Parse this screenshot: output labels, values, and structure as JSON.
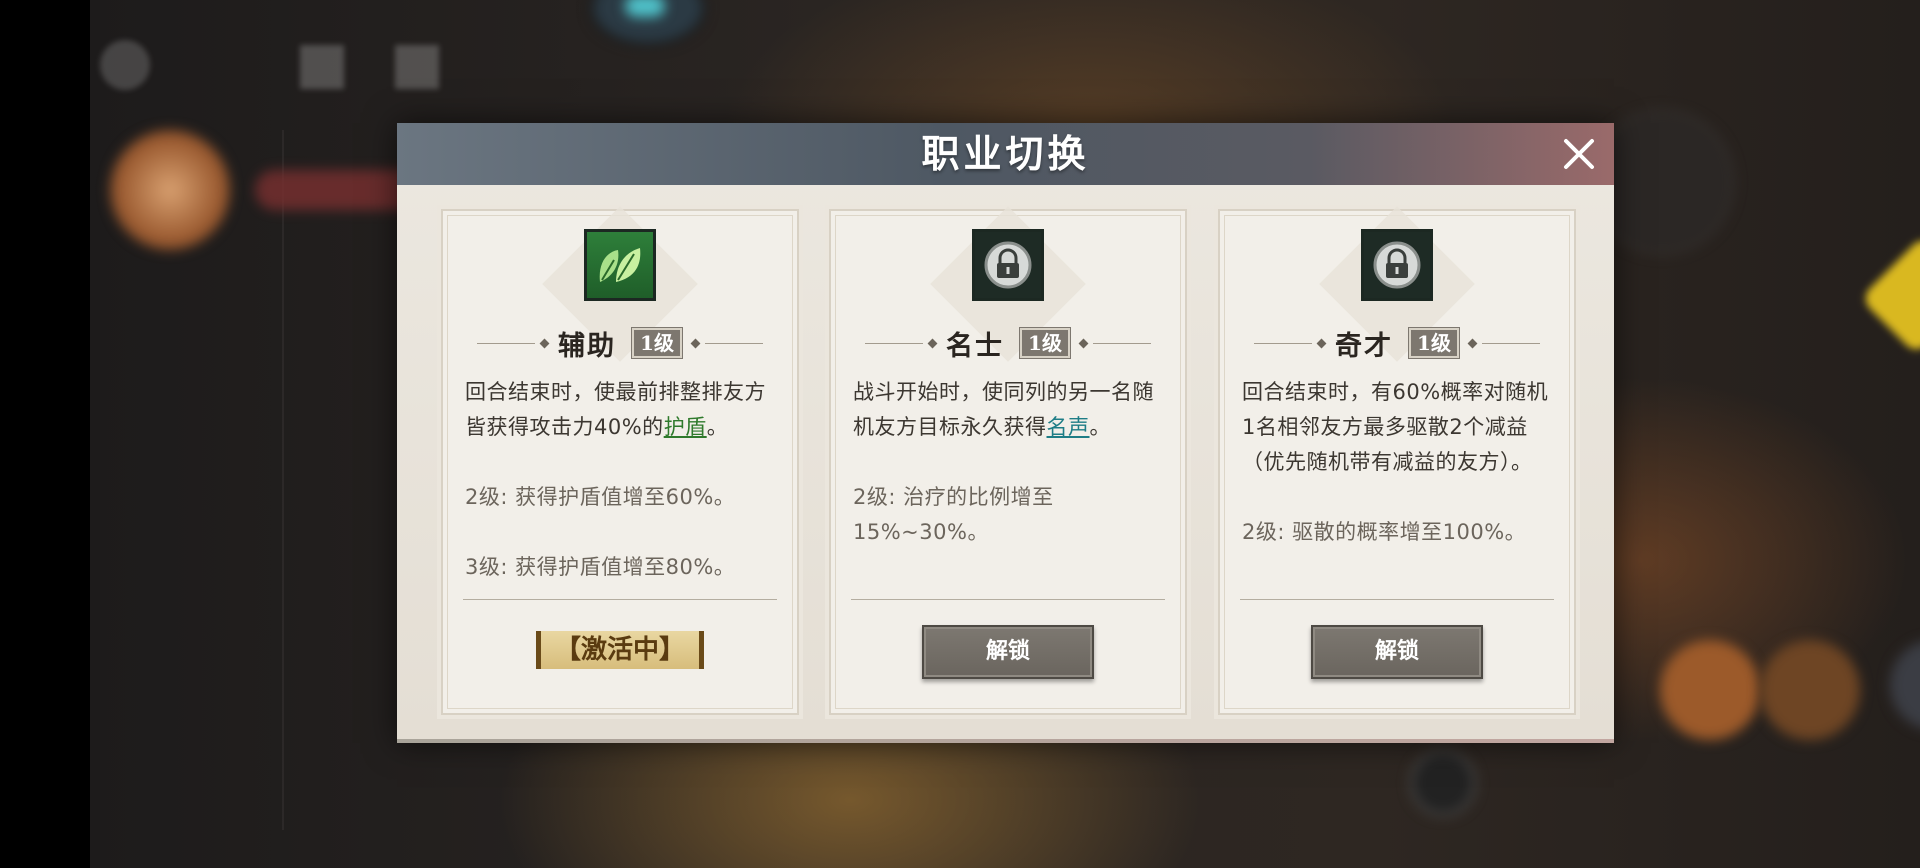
{
  "modal": {
    "title": "职业切换",
    "close_icon": "close-icon"
  },
  "cards": [
    {
      "name": "辅助",
      "level": "1级",
      "icon": "leaf-icon",
      "desc_before": "回合结束时，使最前排整排友方皆获得攻击力40%的",
      "keyword": "护盾",
      "desc_after": "。",
      "level_lines": [
        "2级: 获得护盾值增至60%。",
        "3级: 获得护盾值增至80%。"
      ],
      "status": "【激活中】"
    },
    {
      "name": "名士",
      "level": "1级",
      "icon": "lock-icon",
      "desc_before": "战斗开始时，使同列的另一名随机友方目标永久获得",
      "keyword": "名声",
      "desc_after": "。",
      "level_lines": [
        "2级: 治疗的比例增至15%~30%。"
      ],
      "button": "解锁"
    },
    {
      "name": "奇才",
      "level": "1级",
      "icon": "lock-icon",
      "desc": "回合结束时，有60%概率对随机1名相邻友方最多驱散2个减益（优先随机带有减益的友方）。",
      "level_lines": [
        "2级: 驱散的概率增至100%。"
      ],
      "button": "解锁"
    }
  ],
  "colors": {
    "keyword_green": "#2f7a2c",
    "keyword_teal": "#1e7d86",
    "header": "#4e5863",
    "active": "#d7bd7c"
  }
}
